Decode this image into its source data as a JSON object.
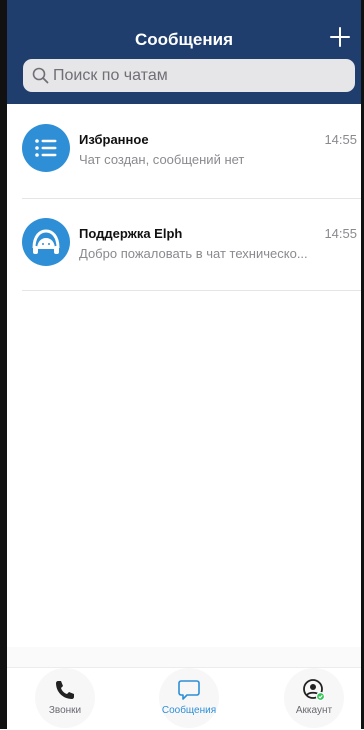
{
  "header": {
    "title": "Сообщения",
    "search_placeholder": "Поиск по чатам"
  },
  "chats": [
    {
      "name": "Избранное",
      "preview": "Чат создан, сообщений нет",
      "time": "14:55",
      "icon": "list-icon"
    },
    {
      "name": "Поддержка Elph",
      "preview": "Добро пожаловать в чат техническо...",
      "time": "14:55",
      "icon": "headset-icon"
    }
  ],
  "tabs": [
    {
      "label": "Звонки",
      "icon": "phone-icon",
      "active": false
    },
    {
      "label": "Сообщения",
      "icon": "chat-bubble-icon",
      "active": true
    },
    {
      "label": "Аккаунт",
      "icon": "account-icon",
      "active": false
    }
  ],
  "colors": {
    "header_bg": "#1f3e6e",
    "accent": "#2e8fd6",
    "status_badge": "#34c759"
  }
}
